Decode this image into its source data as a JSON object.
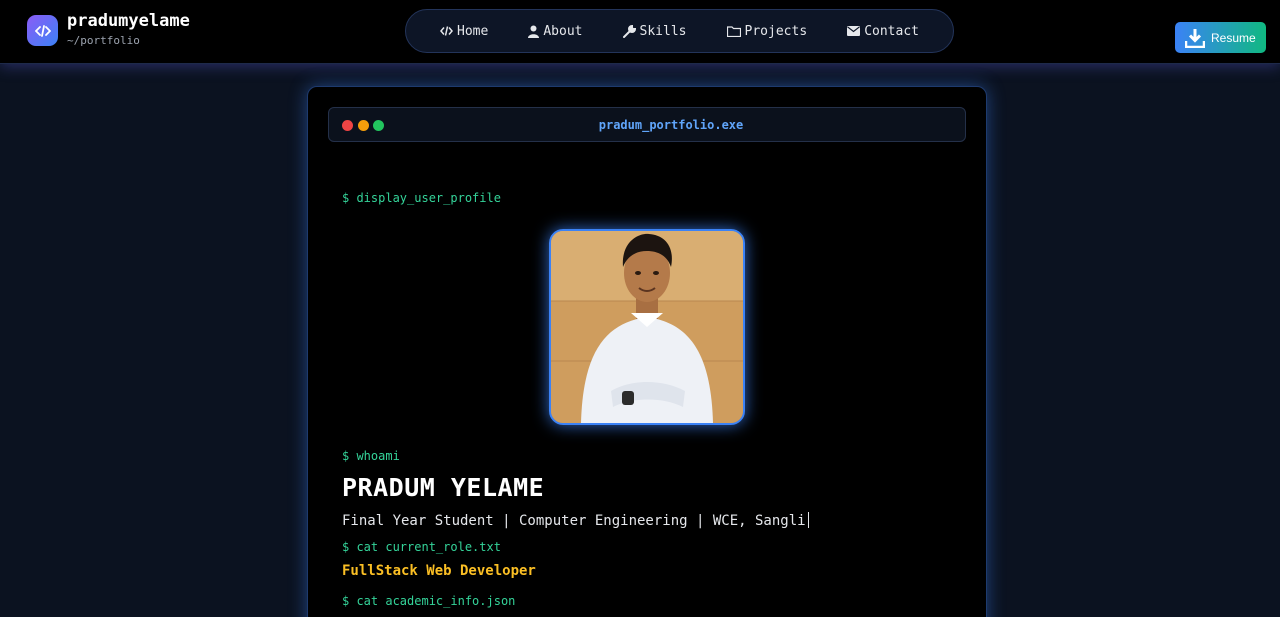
{
  "header": {
    "brand": {
      "name": "pradumyelame",
      "subtitle": "~/portfolio",
      "logo_icon": "code-icon"
    },
    "nav": [
      {
        "label": "Home",
        "icon": "code-icon"
      },
      {
        "label": "About",
        "icon": "user-icon"
      },
      {
        "label": "Skills",
        "icon": "wrench-icon"
      },
      {
        "label": "Projects",
        "icon": "folder-icon"
      },
      {
        "label": "Contact",
        "icon": "envelope-icon"
      }
    ],
    "resume_button": {
      "label": "Resume",
      "icon": "download-icon"
    }
  },
  "terminal": {
    "window_title": "pradum_portfolio.exe",
    "commands": {
      "profile": "$ display_user_profile",
      "whoami": "$ whoami",
      "role": "$ cat current_role.txt",
      "academic": "$ cat academic_info.json"
    },
    "name": "PRADUM YELAME",
    "tagline": "Final Year Student | Computer Engineering | WCE, Sangli",
    "role": "FullStack Web Developer"
  },
  "colors": {
    "accent_blue": "#3b82f6",
    "terminal_green": "#34d399",
    "role_yellow": "#fbbf24",
    "background": "#0b1220"
  }
}
